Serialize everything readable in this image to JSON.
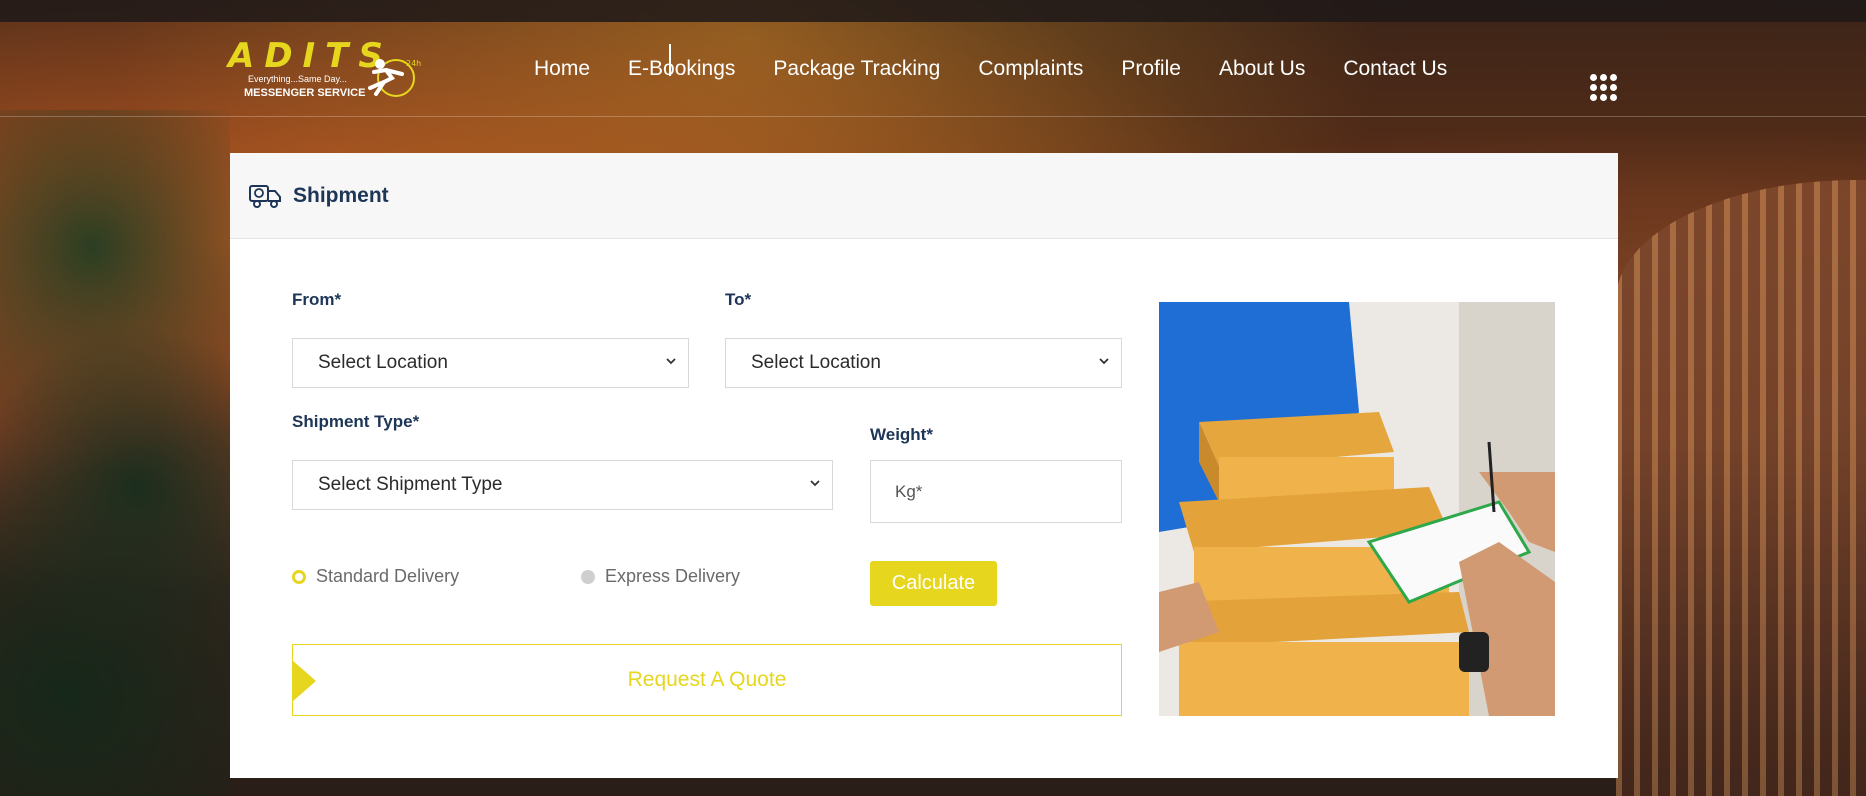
{
  "brand": {
    "logo_letters": "ADITS",
    "tagline": "Everything...Same Day...",
    "service": "MESSENGER SERVICE",
    "badge": "24h",
    "accent_color": "#e6d61e",
    "navy_color": "#1d3557"
  },
  "nav": {
    "items": [
      {
        "label": "Home"
      },
      {
        "label": "E-Bookings"
      },
      {
        "label": "Package Tracking"
      },
      {
        "label": "Complaints"
      },
      {
        "label": "Profile"
      },
      {
        "label": "About Us"
      },
      {
        "label": "Contact Us"
      }
    ],
    "menu_icon": "grid-dots-icon"
  },
  "shipment": {
    "title": "Shipment",
    "icon": "delivery-truck-icon",
    "from": {
      "label": "From*",
      "value": "Select Location"
    },
    "to": {
      "label": "To*",
      "value": "Select Location"
    },
    "type": {
      "label": "Shipment Type*",
      "value": "Select Shipment Type"
    },
    "weight": {
      "label": "Weight*",
      "placeholder": "Kg*"
    },
    "delivery_options": [
      {
        "label": "Standard Delivery",
        "selected": true
      },
      {
        "label": "Express Delivery",
        "selected": false
      }
    ],
    "calculate_label": "Calculate",
    "quote_label": "Request A Quote"
  }
}
